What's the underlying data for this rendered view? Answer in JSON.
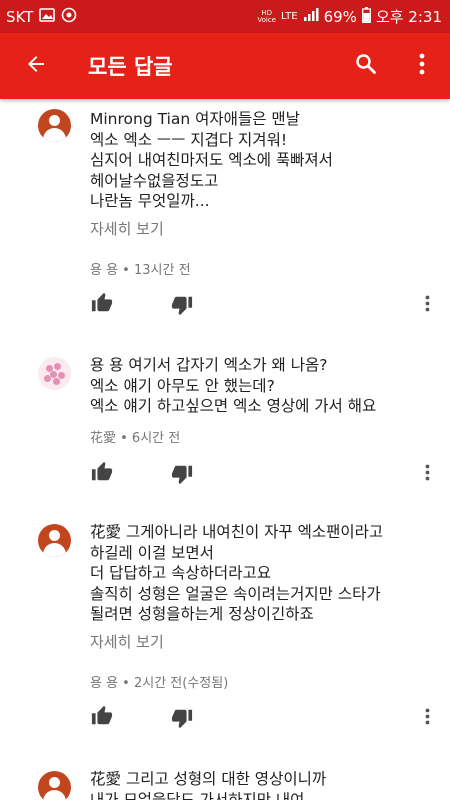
{
  "status_bar": {
    "carrier": "SKT",
    "hd_label": "HD",
    "voice_label": "Voice",
    "lte_label": "LTE",
    "battery": "69%",
    "time": "오후 2:31"
  },
  "app_bar": {
    "title": "모든 답글"
  },
  "colors": {
    "status_bar": "#cc1a1a",
    "app_bar": "#e62117",
    "avatar": "#c1461e",
    "meta_text": "#767676"
  },
  "comments": [
    {
      "author": "Minrong Tian",
      "text": " 여자애들은 맨날\n엑소 엑소 ㅡㅡ 지겹다 지겨워!\n심지어 내여친마저도 엑소에 푹빠져서\n헤어날수없을정도고\n나란놈 무엇일까...",
      "more": "자세히 보기",
      "meta": "용 용 • 13시간 전"
    },
    {
      "author": "용 용",
      "text": " 여기서 갑자기 엑소가 왜 나옴?\n엑소 얘기 아무도 안 했는데?\n엑소 얘기 하고싶으면 엑소 영상에 가서 해요",
      "more": "",
      "meta": "花愛 • 6시간 전"
    },
    {
      "author": "花愛",
      "text": " 그게아니라 내여친이 자꾸 엑소팬이라고\n하길레 이걸 보면서\n더 답답하고 속상하더라고요\n솔직히 성형은 얼굴은 속이려는거지만 스타가\n될려면 성형을하는게 정상이긴하죠",
      "more": "자세히 보기",
      "meta": "용 용 • 2시간 전(수정됨)"
    },
    {
      "author": "花愛",
      "text": " 그리고 성형의 대한 영상이니까\n내가 모얼을닦도 가서하지만 내여",
      "more": "",
      "meta": ""
    }
  ]
}
